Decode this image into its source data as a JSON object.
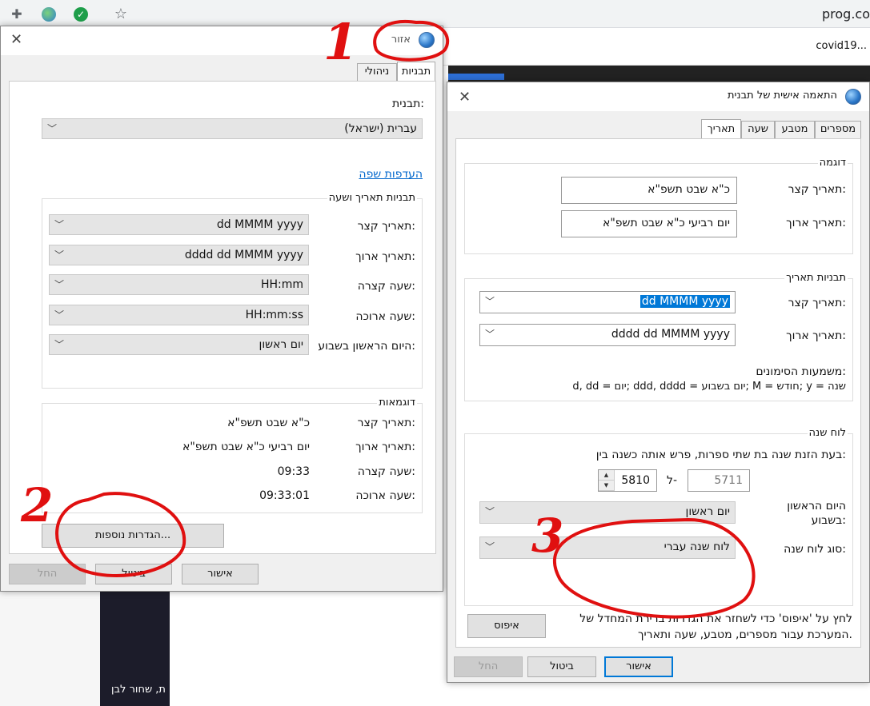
{
  "browser": {
    "url": "prog.co",
    "tab2": "covid19..."
  },
  "background": {
    "dark_text": "ת, שחור לבן"
  },
  "region": {
    "title": "אזור",
    "tabs": [
      "תבניות",
      "ניהולי"
    ],
    "format_label": "תבנית:",
    "format_value": "עברית (ישראל)",
    "lang_link": "העדפות שפה",
    "dt_group": "תבניות תאריך ושעה",
    "dt_rows": [
      {
        "label": "תאריך קצר:",
        "value": "dd MMMM yyyy"
      },
      {
        "label": "תאריך ארוך:",
        "value": "dddd dd MMMM yyyy"
      },
      {
        "label": "שעה קצרה:",
        "value": "HH:mm"
      },
      {
        "label": "שעה ארוכה:",
        "value": "HH:mm:ss"
      },
      {
        "label": "היום הראשון בשבוע:",
        "value": "יום ראשון"
      }
    ],
    "ex_group": "דוגמאות",
    "ex_rows": [
      {
        "label": "תאריך קצר:",
        "value": "כ\"א שבט תשפ\"א"
      },
      {
        "label": "תאריך ארוך:",
        "value": "יום רביעי כ\"א שבט תשפ\"א"
      },
      {
        "label": "שעה קצרה:",
        "value": "09:33"
      },
      {
        "label": "שעה ארוכה:",
        "value": "09:33:01"
      }
    ],
    "more_btn": "הגדרות נוספות...",
    "ok": "אישור",
    "cancel": "ביטול",
    "apply": "החל"
  },
  "custom": {
    "title": "התאמה אישית של תבנית",
    "tabs": [
      "מספרים",
      "מטבע",
      "שעה",
      "תאריך"
    ],
    "ex_group": "דוגמה",
    "ex_short_label": "תאריך קצר:",
    "ex_short_value": "כ\"א שבט תשפ\"א",
    "ex_long_label": "תאריך ארוך:",
    "ex_long_value": "יום רביעי כ\"א שבט תשפ\"א",
    "fmt_group": "תבניות תאריך",
    "fmt_short_label": "תאריך קצר:",
    "fmt_short_value": "dd MMMM yyyy",
    "fmt_long_label": "תאריך ארוך:",
    "fmt_long_value": "dddd dd MMMM yyyy",
    "symbols_title": "משמעות הסימונים:",
    "symbols_text": "d, dd = יום;  ddd, dddd = יום בשבוע;  M = חודש;  y = שנה",
    "cal_group": "לוח שנה",
    "cal_desc": "בעת הזנת שנה בת שתי ספרות, פרש אותה כשנה בין:",
    "year_from": "5711",
    "year_to_sep": "ל-",
    "year_to": "5810",
    "first_day_label_1": "היום הראשון",
    "first_day_label_2": "בשבוע:",
    "first_day_value": "יום ראשון",
    "cal_type_label": "סוג לוח שנה:",
    "cal_type_value": "לוח שנה עברי",
    "reset_text_1": "לחץ על 'איפוס' כדי לשחזר את הגדרות ברירת המחדל של",
    "reset_text_2": "המערכת עבור מספרים, מטבע, שעה ותאריך.",
    "reset_btn": "איפוס",
    "ok": "אישור",
    "cancel": "ביטול",
    "apply": "החל"
  },
  "annotations": {
    "one": "1",
    "two": "2",
    "three": "3",
    "color": "#e01010"
  }
}
